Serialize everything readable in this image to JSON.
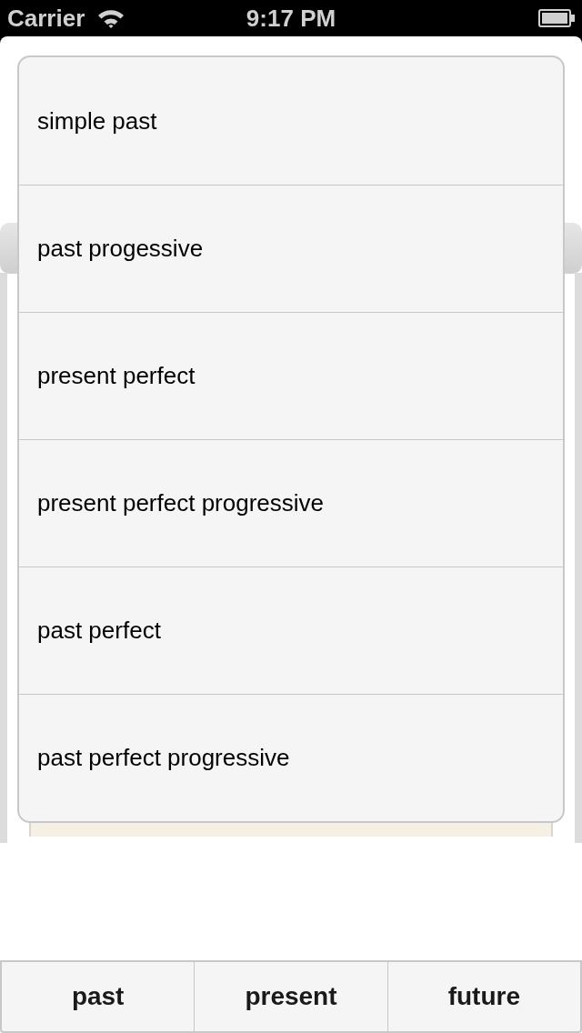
{
  "status_bar": {
    "carrier": "Carrier",
    "time": "9:17 PM"
  },
  "menu": {
    "items": [
      "simple past",
      "past progessive",
      "present perfect",
      "present perfect progressive",
      "past perfect",
      "past perfect progressive"
    ]
  },
  "segment_bar": {
    "buttons": [
      "past",
      "present",
      "future"
    ]
  }
}
